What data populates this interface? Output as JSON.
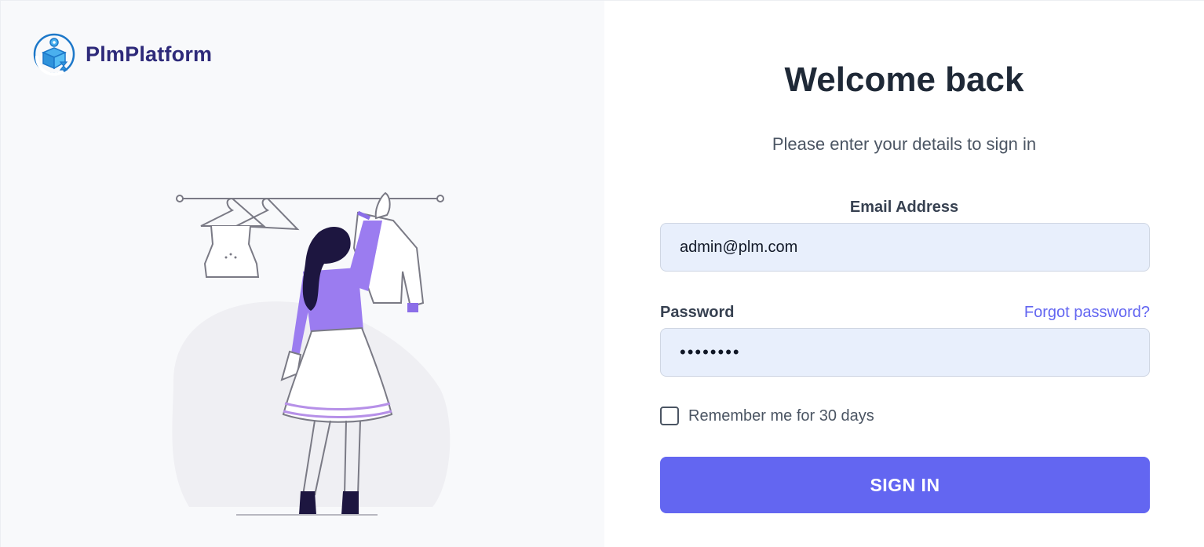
{
  "brand": {
    "name": "PlmPlatform",
    "logo_icon": "box-gear-hourglass-logo"
  },
  "illustration": {
    "icon": "woman-clothes-rack-illustration"
  },
  "form": {
    "title": "Welcome back",
    "subtitle": "Please enter your details to sign in",
    "email_label": "Email Address",
    "email_value": "admin@plm.com",
    "password_label": "Password",
    "password_value": "••••••••",
    "forgot_label": "Forgot password?",
    "remember_label": "Remember me for 30 days",
    "remember_checked": false,
    "submit_label": "SIGN IN"
  },
  "colors": {
    "accent": "#6366f1",
    "brand_text": "#2e2a7a",
    "input_bg": "#e8effc",
    "left_panel_bg": "#f8f9fb"
  }
}
